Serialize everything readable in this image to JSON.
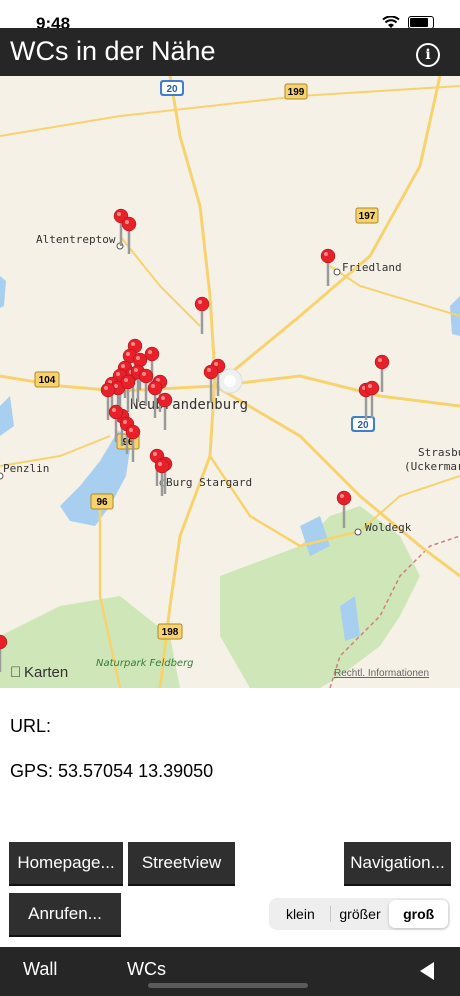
{
  "status": {
    "time": "9:48"
  },
  "header": {
    "title": "WCs in der Nähe",
    "info_icon": "info-circle-icon"
  },
  "map": {
    "places": [
      {
        "name": "Altentreptow"
      },
      {
        "name": "Friedland"
      },
      {
        "name": "Neubrandenburg"
      },
      {
        "name": "Penzlin"
      },
      {
        "name": "Burg Stargard"
      },
      {
        "name": "Woldegk"
      },
      {
        "name": "Strasburg"
      },
      {
        "name": "(Uckermark)"
      },
      {
        "name": "Naturpark Feldberg"
      }
    ],
    "road_badges": [
      "20",
      "199",
      "197",
      "104",
      "20",
      "96",
      "198",
      "96"
    ],
    "brand": "Karten",
    "legal": "Rechtl. Informationen"
  },
  "details": {
    "url": "URL:",
    "gps": "GPS: 53.57054 13.39050"
  },
  "buttons": {
    "homepage": "Homepage...",
    "streetview": "Streetview",
    "navigation": "Navigation...",
    "call": "Anrufen..."
  },
  "size_selector": {
    "options": [
      "klein",
      "größer",
      "groß"
    ],
    "selected": "groß"
  },
  "bottom_bar": {
    "wall": "Wall",
    "wcs": "WCs",
    "back_icon": "back-triangle-icon"
  }
}
